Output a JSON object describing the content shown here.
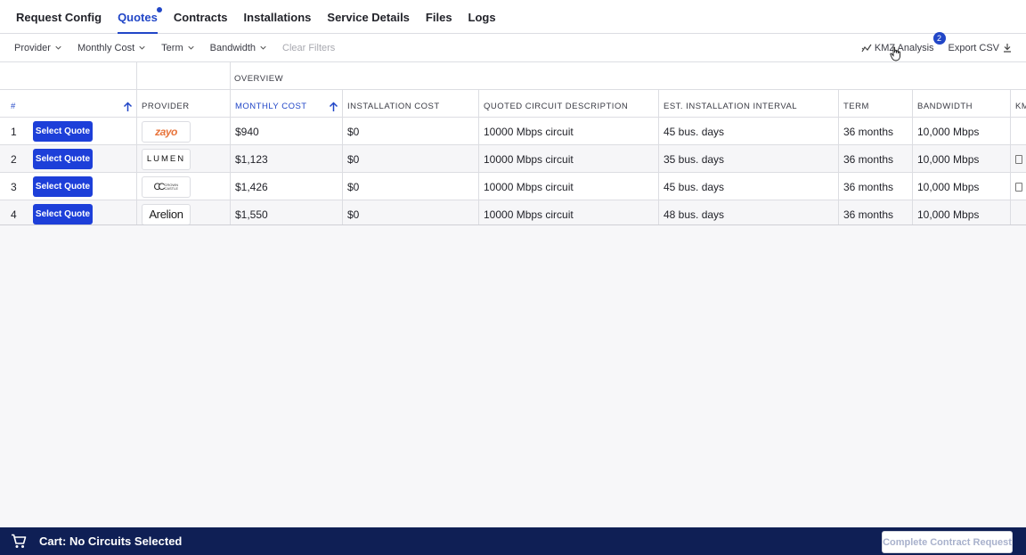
{
  "tabs": [
    {
      "label": "Request Config"
    },
    {
      "label": "Quotes",
      "active": true
    },
    {
      "label": "Contracts"
    },
    {
      "label": "Installations"
    },
    {
      "label": "Service Details"
    },
    {
      "label": "Files"
    },
    {
      "label": "Logs"
    }
  ],
  "filters": {
    "provider": "Provider",
    "monthly_cost": "Monthly Cost",
    "term": "Term",
    "bandwidth": "Bandwidth",
    "clear": "Clear Filters"
  },
  "actions": {
    "kmz_label": "KMZ Analysis",
    "kmz_badge": "2",
    "export_label": "Export CSV"
  },
  "table": {
    "group_label": "OVERVIEW",
    "headers": {
      "index": "#",
      "provider": "PROVIDER",
      "monthly_cost": "MONTHLY COST",
      "installation_cost": "INSTALLATION COST",
      "description": "QUOTED CIRCUIT DESCRIPTION",
      "interval": "EST. INSTALLATION INTERVAL",
      "term": "TERM",
      "bandwidth": "BANDWIDTH",
      "kmz": "KM"
    },
    "select_label": "Select Quote",
    "rows": [
      {
        "index": "1",
        "provider_logo": "zayo",
        "monthly_cost": "$940",
        "installation_cost": "$0",
        "description": "10000 Mbps circuit",
        "interval": "45 bus. days",
        "term": "36 months",
        "bandwidth": "10,000 Mbps"
      },
      {
        "index": "2",
        "provider_logo": "LUMEN",
        "monthly_cost": "$1,123",
        "installation_cost": "$0",
        "description": "10000 Mbps circuit",
        "interval": "35 bus. days",
        "term": "36 months",
        "bandwidth": "10,000 Mbps"
      },
      {
        "index": "3",
        "provider_logo": "CC",
        "provider_logo_sub": "CROWN CASTLE",
        "monthly_cost": "$1,426",
        "installation_cost": "$0",
        "description": "10000 Mbps circuit",
        "interval": "45 bus. days",
        "term": "36 months",
        "bandwidth": "10,000 Mbps"
      },
      {
        "index": "4",
        "provider_logo": "Arelion",
        "monthly_cost": "$1,550",
        "installation_cost": "$0",
        "description": "10000 Mbps circuit",
        "interval": "48 bus. days",
        "term": "36 months",
        "bandwidth": "10,000 Mbps"
      }
    ]
  },
  "footer": {
    "cart_label": "Cart: No Circuits Selected",
    "complete_label": "Complete Contract Request"
  },
  "colors": {
    "accent": "#2146c7",
    "button": "#1d3fd9",
    "footer": "#0f1f55"
  }
}
